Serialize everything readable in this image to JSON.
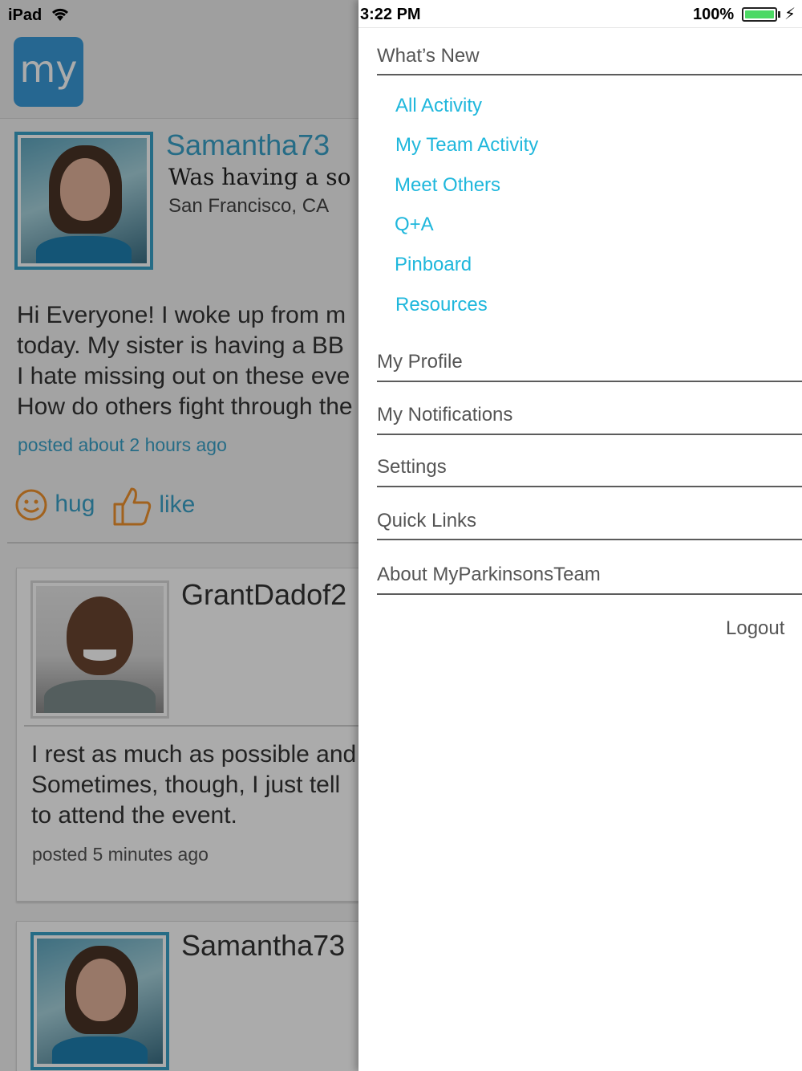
{
  "status": {
    "device": "iPad",
    "time": "3:22 PM",
    "battery": "100%",
    "battery_level": 1.0
  },
  "app": {
    "logo_text": "my"
  },
  "feed": {
    "post1": {
      "username": "Samantha73",
      "title": "Was having a so",
      "location": "San Francisco, CA",
      "body_lines": [
        "Hi Everyone! I woke up from m",
        "today.  My sister is having a BB",
        "I hate missing out on these eve",
        "How do others fight through the"
      ],
      "time": "posted about 2 hours ago",
      "hug_label": "hug",
      "like_label": "like"
    },
    "post2": {
      "username": "GrantDadof2",
      "body_lines": [
        "I rest as much as possible and",
        "Sometimes, though, I just tell",
        "to attend the event."
      ],
      "time": "posted 5 minutes ago"
    },
    "post3": {
      "username": "Samantha73"
    }
  },
  "menu": {
    "whats_new": "What’s New",
    "sub_items": [
      {
        "label": "All Activity"
      },
      {
        "label": "My Team Activity"
      },
      {
        "label": "Meet Others"
      },
      {
        "label": "Q+A"
      },
      {
        "label": "Pinboard"
      },
      {
        "label": "Resources"
      }
    ],
    "my_profile": "My Profile",
    "my_notifications": "My Notifications",
    "settings": "Settings",
    "quick_links": "Quick Links",
    "about": "About MyParkinsonsTeam",
    "logout": "Logout"
  },
  "colors": {
    "accent": "#1fb7dc",
    "feed_accent": "#3aa1c8",
    "reaction": "#f0922e",
    "logo": "#3a9ad9",
    "battery": "#4cd964"
  }
}
